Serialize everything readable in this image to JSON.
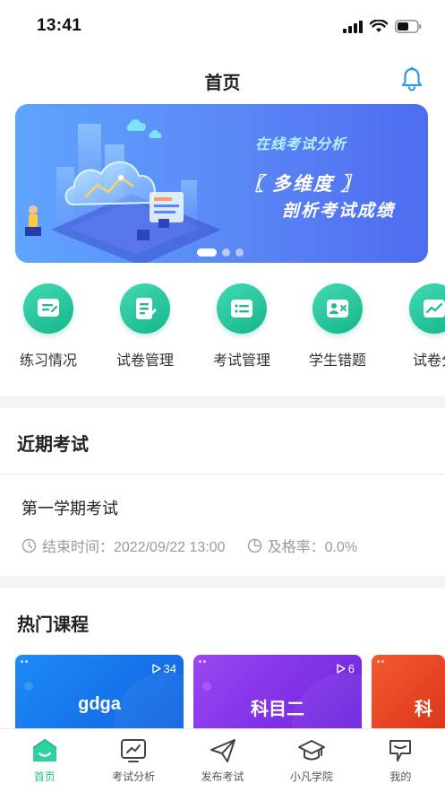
{
  "status_bar": {
    "time": "13:41"
  },
  "nav": {
    "title": "首页"
  },
  "banner": {
    "subtitle": "在线考试分析",
    "line1": "〖 多维度 〗",
    "line2": "剖析考试成绩",
    "page_count": 3,
    "active_page": 1
  },
  "quick_actions": [
    {
      "label": "练习情况",
      "icon": "practice-icon"
    },
    {
      "label": "试卷管理",
      "icon": "paper-edit-icon"
    },
    {
      "label": "考试管理",
      "icon": "exam-list-icon"
    },
    {
      "label": "学生错题",
      "icon": "student-error-icon"
    },
    {
      "label": "试卷分",
      "icon": "paper-analysis-icon"
    }
  ],
  "recent_exams": {
    "title": "近期考试",
    "items": [
      {
        "name": "第一学期考试",
        "end_time": "结束时间：2022/09/22 13:00",
        "pass_rate": "及格率：0.0%"
      }
    ]
  },
  "hot_courses": {
    "title": "热门课程",
    "items": [
      {
        "title": "gdga",
        "count": "34",
        "color_from": "#1d8bf5",
        "color_to": "#0f5fe0"
      },
      {
        "title": "科目二",
        "count": "6",
        "color_from": "#8b3cf0",
        "color_to": "#6a1fdc"
      },
      {
        "title": "科",
        "count": "",
        "color_from": "#f04a2a",
        "color_to": "#d8321a"
      }
    ]
  },
  "tab_bar": [
    {
      "label": "首页",
      "icon": "home-icon",
      "active": true
    },
    {
      "label": "考试分析",
      "icon": "chart-icon",
      "active": false
    },
    {
      "label": "发布考试",
      "icon": "send-icon",
      "active": false
    },
    {
      "label": "小凡学院",
      "icon": "graduation-cap-icon",
      "active": false
    },
    {
      "label": "我的",
      "icon": "profile-icon",
      "active": false
    }
  ],
  "colors": {
    "accent": "#1fbf93",
    "banner": "#5b86f5"
  }
}
